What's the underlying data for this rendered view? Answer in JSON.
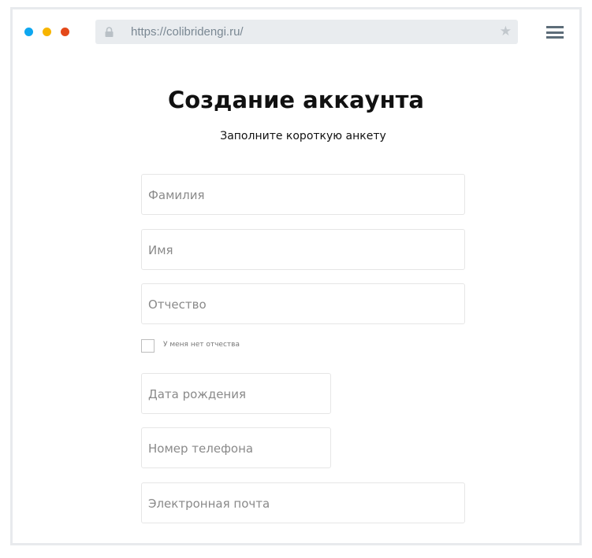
{
  "browser": {
    "window_dots": [
      "#0ea7f0",
      "#f7b500",
      "#e4491a"
    ],
    "url": "https://colibridengi.ru/",
    "lock_icon": "lock-icon",
    "star_icon": "star-icon",
    "menu_icon": "hamburger-icon"
  },
  "page": {
    "title": "Создание аккаунта",
    "subtitle": "Заполните короткую анкету",
    "fields": {
      "last_name": "Фамилия",
      "first_name": "Имя",
      "patronymic": "Отчество",
      "birth_date": "Дата рождения",
      "phone": "Номер телефона",
      "email": "Электронная почта"
    },
    "no_patronymic_label": "У меня нет отчества"
  }
}
